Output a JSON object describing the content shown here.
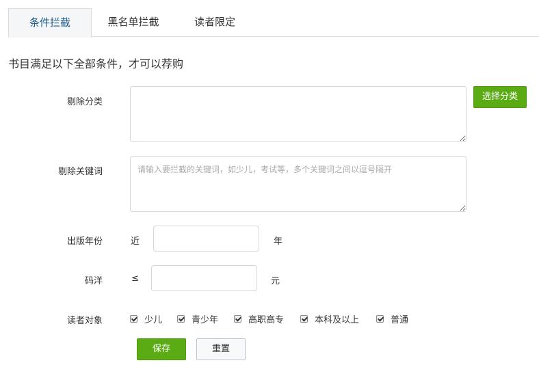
{
  "tabs": [
    {
      "label": "条件拦截",
      "active": true
    },
    {
      "label": "黑名单拦截",
      "active": false
    },
    {
      "label": "读者限定",
      "active": false
    }
  ],
  "intro": "书目满足以下全部条件，才可以荐购",
  "exclude_category": {
    "label": "剔除分类",
    "value": "",
    "button": "选择分类"
  },
  "exclude_keywords": {
    "label": "剔除关键词",
    "placeholder": "请输入要拦截的关键词，如少儿，考试等，多个关键词之间以逗号隔开"
  },
  "pub_year": {
    "label": "出版年份",
    "prefix": "近",
    "suffix": "年",
    "value": ""
  },
  "price": {
    "label": "码洋",
    "prefix": "≤",
    "suffix": "元",
    "value": ""
  },
  "readers": {
    "label": "读者对象",
    "options": [
      {
        "label": "少儿",
        "checked": true
      },
      {
        "label": "青少年",
        "checked": true
      },
      {
        "label": "高职高专",
        "checked": true
      },
      {
        "label": "本科及以上",
        "checked": true
      },
      {
        "label": "普通",
        "checked": true
      }
    ]
  },
  "actions": {
    "save": "保存",
    "reset": "重置"
  },
  "colors": {
    "accent_green": "#5aab14",
    "active_tab_text": "#1d5a8e"
  }
}
